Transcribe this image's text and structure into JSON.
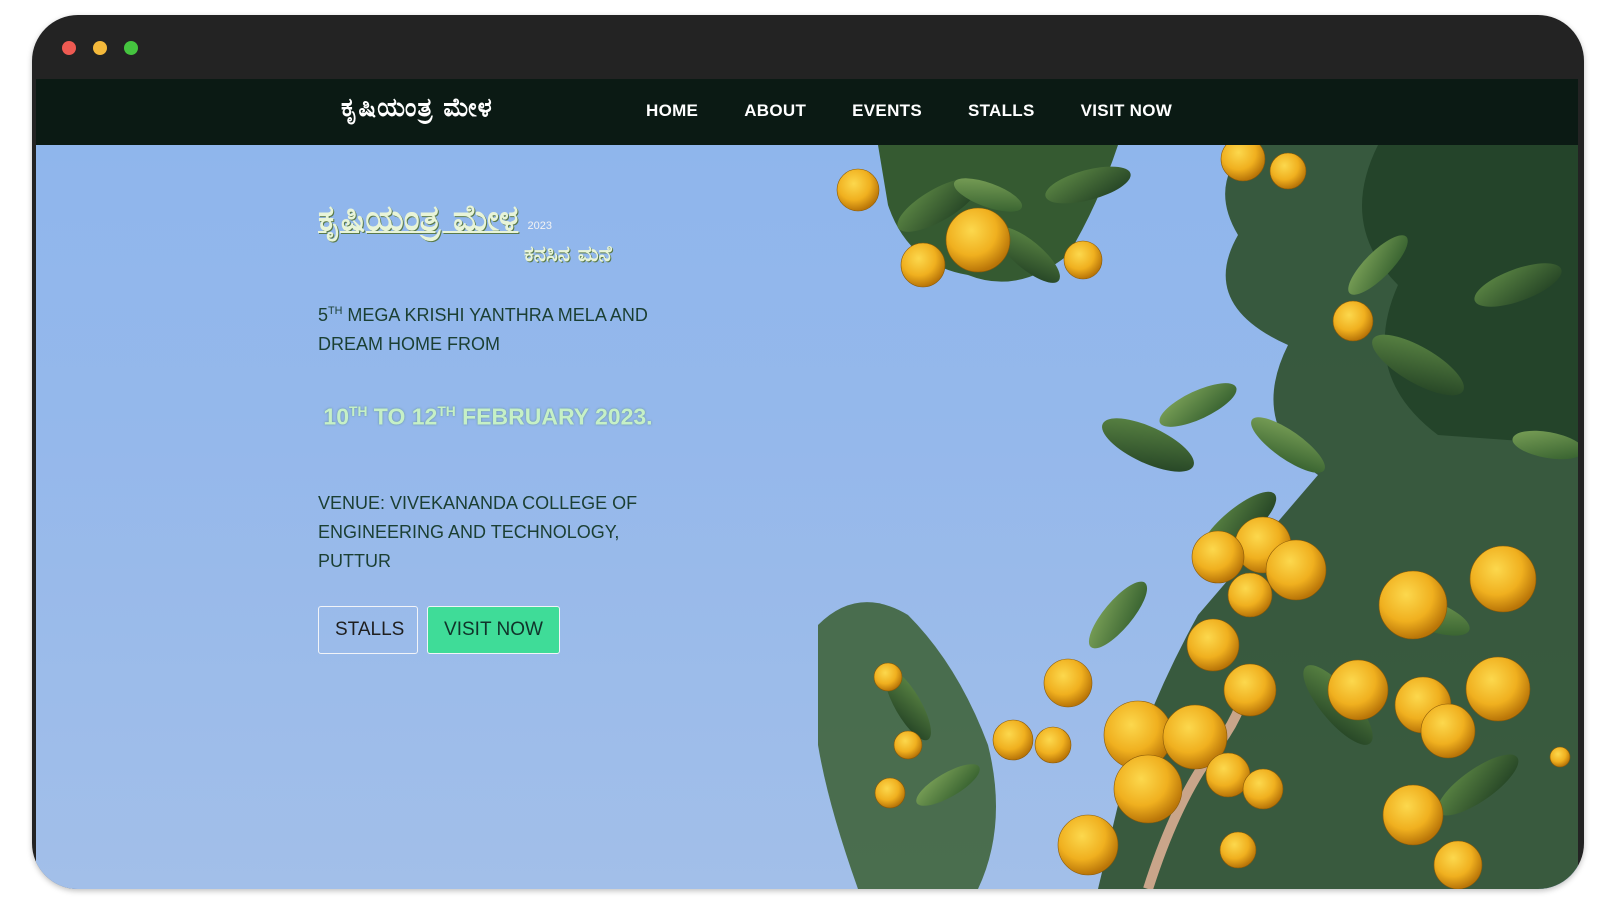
{
  "window": {
    "controls": [
      "close",
      "minimize",
      "maximize"
    ]
  },
  "nav": {
    "logo": "ಕೃಷಿಯಂತ್ರ ಮೇಳ",
    "items": [
      {
        "label": "HOME"
      },
      {
        "label": "ABOUT"
      },
      {
        "label": "EVENTS"
      },
      {
        "label": "STALLS"
      },
      {
        "label": "VISIT NOW"
      }
    ]
  },
  "hero": {
    "logo_main": "ಕೃಷಿಯಂತ್ರ ಮೇಳ",
    "logo_year": "2023",
    "logo_sub": "ಕನಸಿನ ಮನೆ",
    "tagline_num": "5",
    "tagline_sup": "TH",
    "tagline_rest": " MEGA KRISHI YANTHRA MELA AND DREAM HOME FROM",
    "date_start": "10",
    "date_start_sup": "TH",
    "date_mid": " TO 12",
    "date_end_sup": "TH",
    "date_rest": " FEBRUARY 2023.",
    "venue": "VENUE: VIVEKANANDA COLLEGE OF ENGINEERING AND TECHNOLOGY, PUTTUR",
    "buttons": {
      "stalls": "STALLS",
      "visit": "VISIT NOW"
    }
  },
  "colors": {
    "navbar_bg": "#0b1a14",
    "sky": "#8db4ea",
    "accent_button": "#3fdc98",
    "dates_text": "#c6f0c6"
  }
}
